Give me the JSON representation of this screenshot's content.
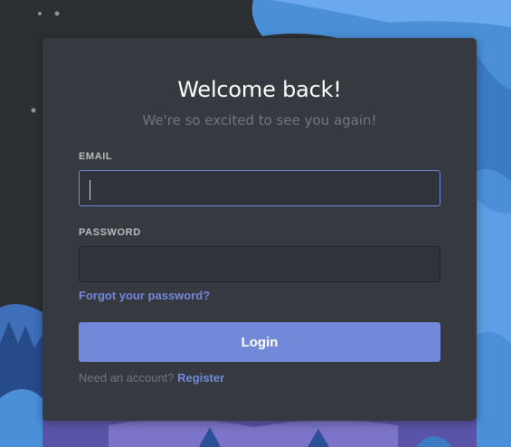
{
  "login": {
    "title": "Welcome back!",
    "subtitle": "We're so excited to see you again!",
    "email_label": "EMAIL",
    "email_value": "",
    "password_label": "PASSWORD",
    "password_value": "",
    "forgot_password": "Forgot your password?",
    "login_button": "Login",
    "need_account": "Need an account?",
    "register_link": "Register"
  },
  "colors": {
    "accent": "#7289da",
    "card": "#36393f",
    "input": "#303339",
    "background": "#2c2f33",
    "illustration_blue": "#4a8fd8"
  }
}
